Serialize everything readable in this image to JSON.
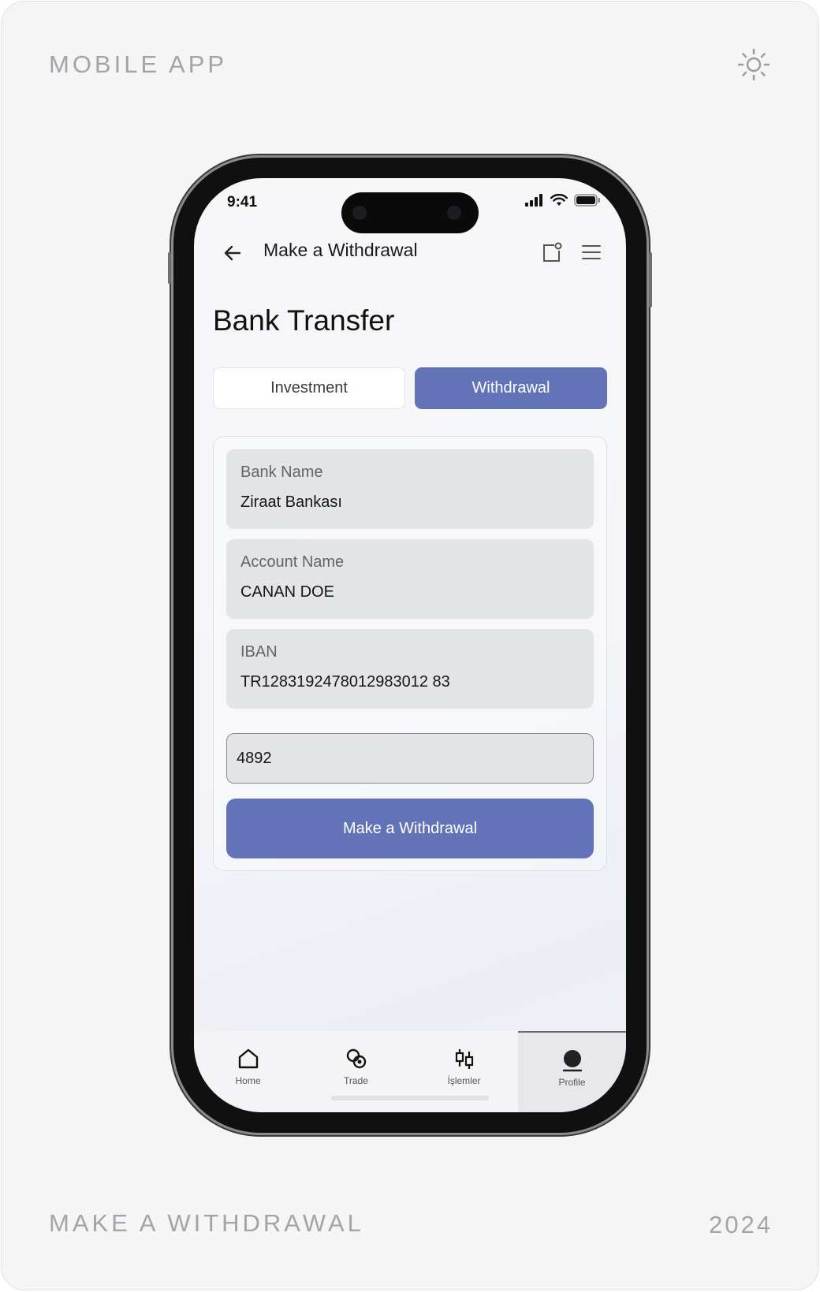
{
  "frame": {
    "top_label": "MOBILE APP",
    "bottom_label": "MAKE A WITHDRAWAL",
    "year": "2024",
    "theme_icon": "sun-icon"
  },
  "status_bar": {
    "time": "9:41"
  },
  "header": {
    "title": "Make a Withdrawal"
  },
  "page": {
    "title": "Bank Transfer"
  },
  "tabs": [
    {
      "label": "Investment",
      "active": false
    },
    {
      "label": "Withdrawal",
      "active": true
    }
  ],
  "form": {
    "bank_name": {
      "label": "Bank Name",
      "value": "Ziraat Bankası"
    },
    "account_name": {
      "label": "Account Name",
      "value": "CANAN DOE"
    },
    "iban": {
      "label": "IBAN",
      "value": "TR1283192478012983012 83"
    },
    "code_input": {
      "value": "4892"
    },
    "submit_label": "Make a Withdrawal"
  },
  "nav": [
    {
      "label": "Home",
      "icon": "home-icon"
    },
    {
      "label": "Trade",
      "icon": "trade-icon"
    },
    {
      "label": "İşlemler",
      "icon": "candlestick-icon"
    },
    {
      "label": "Profile",
      "icon": "profile-icon",
      "active": true
    }
  ],
  "colors": {
    "accent": "#6373b8",
    "field_bg": "#e3e4e8"
  }
}
